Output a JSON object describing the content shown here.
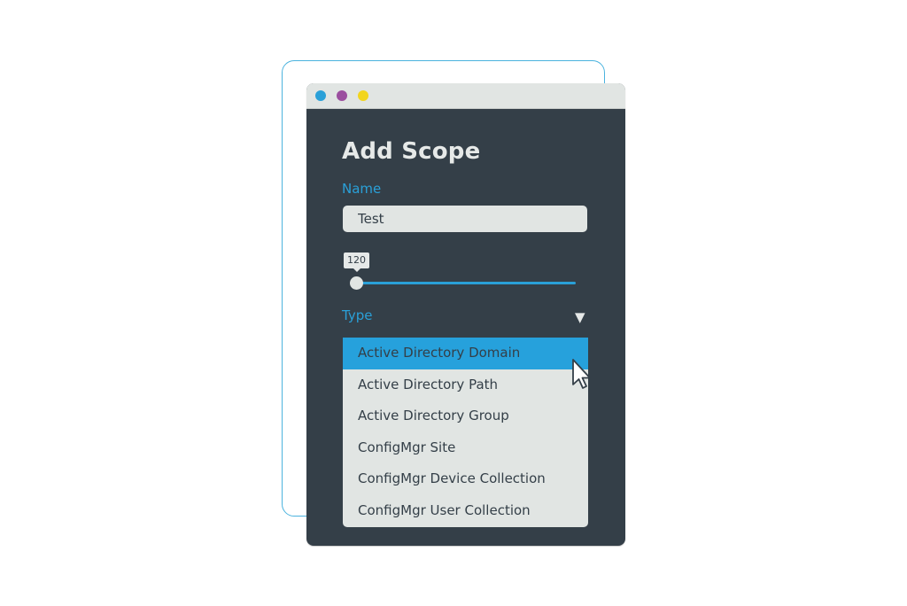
{
  "window": {
    "traffic_lights": [
      {
        "name": "blue",
        "color": "#2aa0d8"
      },
      {
        "name": "purple",
        "color": "#9b4f9f"
      },
      {
        "name": "yellow",
        "color": "#f2d51e"
      }
    ]
  },
  "dialog": {
    "title": "Add Scope",
    "name_label": "Name",
    "name_value": "Test",
    "slider": {
      "value_label": "120",
      "value": 120
    },
    "type_label": "Type",
    "type_caret_icon": "▼",
    "type_options": [
      "Active Directory Domain",
      "Active Directory Path",
      "Active Directory Group",
      "ConfigMgr Site",
      "ConfigMgr Device Collection",
      "ConfigMgr User Collection"
    ],
    "selected_option_index": 0
  },
  "colors": {
    "accent": "#2aa0d8",
    "panel": "#343f48",
    "light": "#e1e5e3",
    "frame_outline": "#4bb3de"
  }
}
